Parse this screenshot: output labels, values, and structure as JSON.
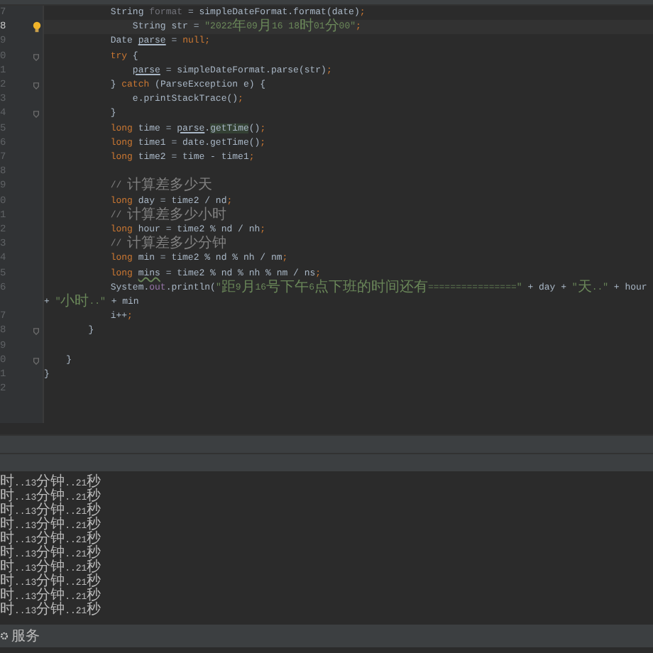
{
  "editor": {
    "lines": [
      {
        "number": "7",
        "current": false,
        "fold": false,
        "bulb": false,
        "tokens": [
          {
            "kind": "plain",
            "text": "            String "
          },
          {
            "kind": "unused",
            "text": "format"
          },
          {
            "kind": "plain",
            "text": " = simpleDateFormat.format(date)"
          },
          {
            "kind": "keyword",
            "text": ";"
          }
        ]
      },
      {
        "number": "8",
        "current": true,
        "fold": false,
        "bulb": true,
        "tokens": [
          {
            "kind": "plain",
            "text": "                String str = "
          },
          {
            "kind": "string",
            "text": "\"2022年09月16 18时01分00\""
          },
          {
            "kind": "keyword",
            "text": ";"
          }
        ]
      },
      {
        "number": "9",
        "current": false,
        "fold": false,
        "bulb": false,
        "tokens": [
          {
            "kind": "plain",
            "text": "            Date "
          },
          {
            "kind": "ref",
            "text": "parse"
          },
          {
            "kind": "plain",
            "text": " = "
          },
          {
            "kind": "keyword",
            "text": "null;"
          }
        ]
      },
      {
        "number": "0",
        "current": false,
        "fold": true,
        "bulb": false,
        "tokens": [
          {
            "kind": "keyword",
            "text": "            try"
          },
          {
            "kind": "plain",
            "text": " {"
          }
        ]
      },
      {
        "number": "1",
        "current": false,
        "fold": false,
        "bulb": false,
        "tokens": [
          {
            "kind": "ref",
            "text": "                parse"
          },
          {
            "kind": "plain",
            "text": " = simpleDateFormat.parse(str)"
          },
          {
            "kind": "keyword",
            "text": ";"
          }
        ]
      },
      {
        "number": "2",
        "current": false,
        "fold": true,
        "bulb": false,
        "tokens": [
          {
            "kind": "plain",
            "text": "            } "
          },
          {
            "kind": "keyword",
            "text": "catch"
          },
          {
            "kind": "plain",
            "text": " (ParseException e) {"
          }
        ]
      },
      {
        "number": "3",
        "current": false,
        "fold": false,
        "bulb": false,
        "tokens": [
          {
            "kind": "plain",
            "text": "                e.printStackTrace()"
          },
          {
            "kind": "keyword",
            "text": ";"
          }
        ]
      },
      {
        "number": "4",
        "current": false,
        "fold": true,
        "bulb": false,
        "tokens": [
          {
            "kind": "plain",
            "text": "            }"
          }
        ]
      },
      {
        "number": "5",
        "current": false,
        "fold": false,
        "bulb": false,
        "tokens": [
          {
            "kind": "keyword",
            "text": "            long"
          },
          {
            "kind": "plain",
            "text": " time = "
          },
          {
            "kind": "ref",
            "text": "parse"
          },
          {
            "kind": "plain",
            "text": "."
          },
          {
            "kind": "highlight",
            "text": "getTime"
          },
          {
            "kind": "plain",
            "text": "()"
          },
          {
            "kind": "keyword",
            "text": ";"
          }
        ]
      },
      {
        "number": "6",
        "current": false,
        "fold": false,
        "bulb": false,
        "tokens": [
          {
            "kind": "keyword",
            "text": "            long"
          },
          {
            "kind": "plain",
            "text": " time1 = date.getTime()"
          },
          {
            "kind": "keyword",
            "text": ";"
          }
        ]
      },
      {
        "number": "7",
        "current": false,
        "fold": false,
        "bulb": false,
        "tokens": [
          {
            "kind": "keyword",
            "text": "            long"
          },
          {
            "kind": "plain",
            "text": " time2 = time - time1"
          },
          {
            "kind": "keyword",
            "text": ";"
          }
        ]
      },
      {
        "number": "8",
        "current": false,
        "fold": false,
        "bulb": false
      },
      {
        "number": "9",
        "current": false,
        "fold": false,
        "bulb": false,
        "tokens": [
          {
            "kind": "comment",
            "text": "            // 计算差多少天"
          }
        ]
      },
      {
        "number": "0",
        "current": false,
        "fold": false,
        "bulb": false,
        "tokens": [
          {
            "kind": "keyword",
            "text": "            long"
          },
          {
            "kind": "plain",
            "text": " day = time2 / nd"
          },
          {
            "kind": "keyword",
            "text": ";"
          }
        ]
      },
      {
        "number": "1",
        "current": false,
        "fold": false,
        "bulb": false,
        "tokens": [
          {
            "kind": "comment",
            "text": "            // 计算差多少小时"
          }
        ]
      },
      {
        "number": "2",
        "current": false,
        "fold": false,
        "bulb": false,
        "tokens": [
          {
            "kind": "keyword",
            "text": "            long"
          },
          {
            "kind": "plain",
            "text": " hour = time2 % nd / nh"
          },
          {
            "kind": "keyword",
            "text": ";"
          }
        ]
      },
      {
        "number": "3",
        "current": false,
        "fold": false,
        "bulb": false,
        "tokens": [
          {
            "kind": "comment",
            "text": "            // 计算差多少分钟"
          }
        ]
      },
      {
        "number": "4",
        "current": false,
        "fold": false,
        "bulb": false,
        "tokens": [
          {
            "kind": "keyword",
            "text": "            long"
          },
          {
            "kind": "plain",
            "text": " min = time2 % nd % nh / nm"
          },
          {
            "kind": "keyword",
            "text": ";"
          }
        ]
      },
      {
        "number": "5",
        "current": false,
        "fold": false,
        "bulb": false,
        "tokens": [
          {
            "kind": "keyword",
            "text": "            long "
          },
          {
            "kind": "warn",
            "text": "mins"
          },
          {
            "kind": "plain",
            "text": " = time2 % nd % nh % nm / ns"
          },
          {
            "kind": "keyword",
            "text": ";"
          }
        ]
      },
      {
        "number": "6",
        "current": false,
        "fold": false,
        "bulb": false,
        "tokens": [
          {
            "kind": "plain",
            "text": "            System."
          },
          {
            "kind": "field",
            "text": "out"
          },
          {
            "kind": "plain",
            "text": ".println("
          },
          {
            "kind": "string",
            "text": "\"距9月16号下午6点下班的时间还有================\""
          },
          {
            "kind": "plain",
            "text": " + day + "
          },
          {
            "kind": "string",
            "text": "\"天..\""
          },
          {
            "kind": "plain",
            "text": " + hour + "
          },
          {
            "kind": "string",
            "text": "\"小时..\""
          },
          {
            "kind": "plain",
            "text": " + min"
          }
        ]
      },
      {
        "number": "7",
        "current": false,
        "fold": false,
        "bulb": false,
        "tokens": [
          {
            "kind": "plain",
            "text": "            i++"
          },
          {
            "kind": "keyword",
            "text": ";"
          }
        ]
      },
      {
        "number": "8",
        "current": false,
        "fold": true,
        "bulb": false,
        "tokens": [
          {
            "kind": "plain",
            "text": "        }"
          }
        ]
      },
      {
        "number": "9",
        "current": false,
        "fold": false,
        "bulb": false
      },
      {
        "number": "0",
        "current": false,
        "fold": true,
        "bulb": false,
        "tokens": [
          {
            "kind": "plain",
            "text": "    }"
          }
        ]
      },
      {
        "number": "1",
        "current": false,
        "fold": false,
        "bulb": false,
        "tokens": [
          {
            "kind": "plain",
            "text": "}"
          }
        ]
      },
      {
        "number": "2",
        "current": false,
        "fold": false,
        "bulb": false
      }
    ]
  },
  "console": {
    "lines": [
      "时..13分钟..21秒",
      "时..13分钟..21秒",
      "时..13分钟..21秒",
      "时..13分钟..21秒",
      "时..13分钟..21秒",
      "时..13分钟..21秒",
      "时..13分钟..21秒",
      "时..13分钟..21秒",
      "时..13分钟..21秒",
      "时..13分钟..21秒"
    ]
  },
  "status_bar": {
    "label": "服务"
  }
}
